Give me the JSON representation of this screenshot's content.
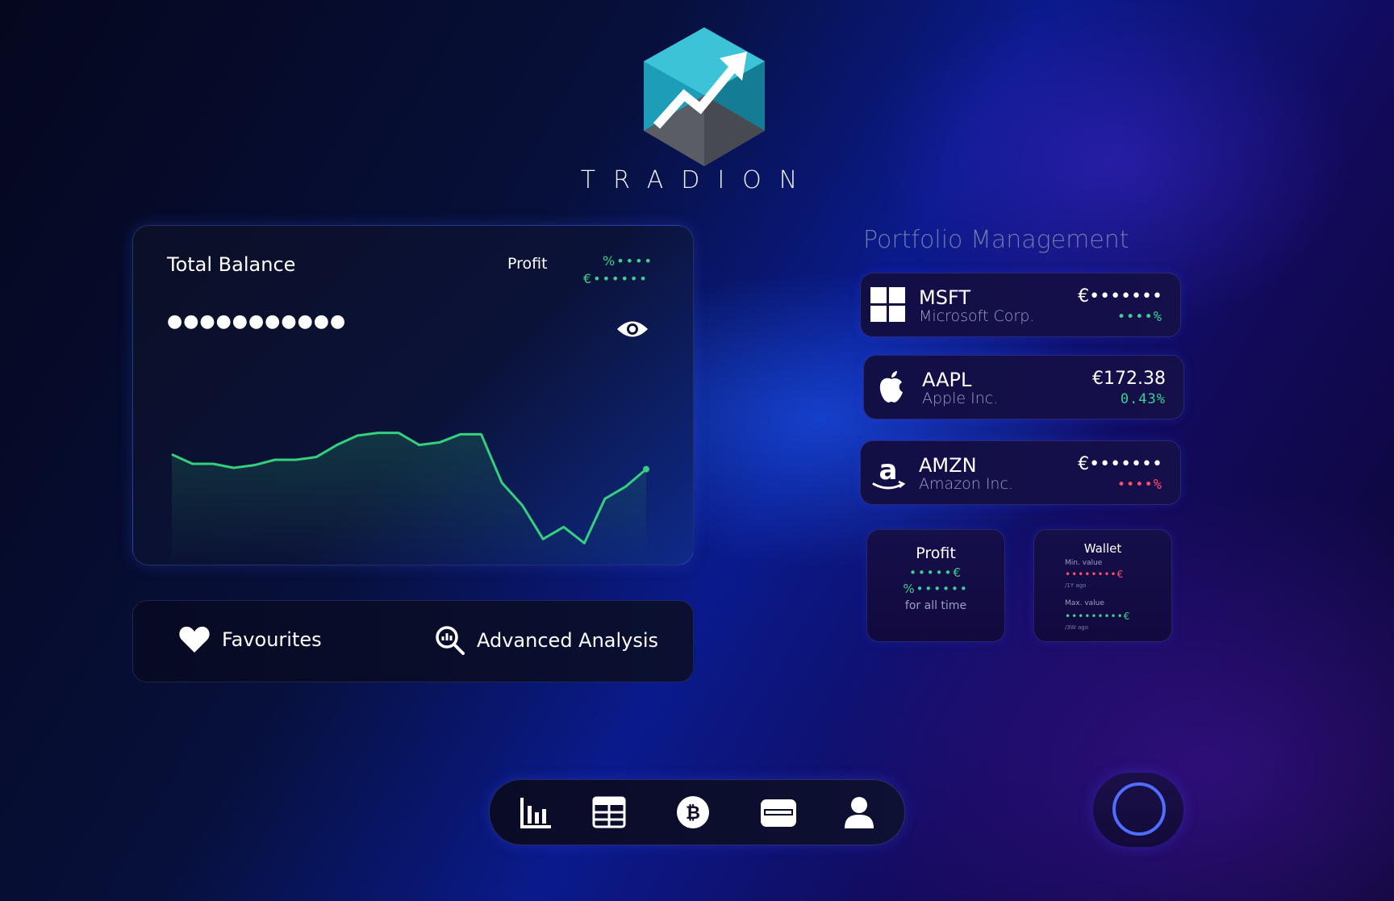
{
  "brand": {
    "name": "TRADION"
  },
  "balance_card": {
    "title": "Total Balance",
    "profit_label": "Profit",
    "profit_pct_masked": "%••••",
    "profit_eur_masked": "€••••••",
    "balance_masked": "●●●●●●●●●●●"
  },
  "balance_chart": {
    "type": "line",
    "values": [
      50,
      43,
      43,
      40,
      42,
      46,
      46,
      48,
      57,
      64,
      66,
      66,
      57,
      59,
      65,
      65,
      29,
      12,
      -13,
      -4,
      -16,
      17,
      26,
      39
    ],
    "line_color": "#34d07e"
  },
  "actions": {
    "favourites": "Favourites",
    "advanced_analysis": "Advanced Analysis"
  },
  "portfolio": {
    "title": "Portfolio Management",
    "stocks": [
      {
        "ticker": "MSFT",
        "company": "Microsoft Corp.",
        "price": "€•••••••",
        "change": "••••%",
        "change_color": "#3ad28c",
        "icon": "windows-logo-icon"
      },
      {
        "ticker": "AAPL",
        "company": "Apple Inc.",
        "price": "€172.38",
        "change": "0.43%",
        "change_color": "#3ad28c",
        "icon": "apple-logo-icon"
      },
      {
        "ticker": "AMZN",
        "company": "Amazon Inc.",
        "price": "€•••••••",
        "change": "••••%",
        "change_color": "#ff4d6d",
        "icon": "amazon-logo-icon"
      }
    ]
  },
  "profit_mini": {
    "title": "Profit",
    "eur_masked": "•••••€",
    "pct_masked": "%••••••",
    "caption": "for all time"
  },
  "wallet_mini": {
    "title": "Wallet",
    "min_label": "Min. value",
    "min_masked": "••••••••€",
    "min_caption": "/1Y ago",
    "max_label": "Max. value",
    "max_masked": "•••••••••€",
    "max_caption": "/3W ago"
  },
  "nav": {
    "items": [
      "bar-chart-icon",
      "calendar-icon",
      "bitcoin-icon",
      "wallet-icon",
      "user-icon"
    ]
  },
  "colors": {
    "positive": "#3ad28c",
    "negative": "#ff4d6d",
    "accent": "#4f6dff"
  }
}
